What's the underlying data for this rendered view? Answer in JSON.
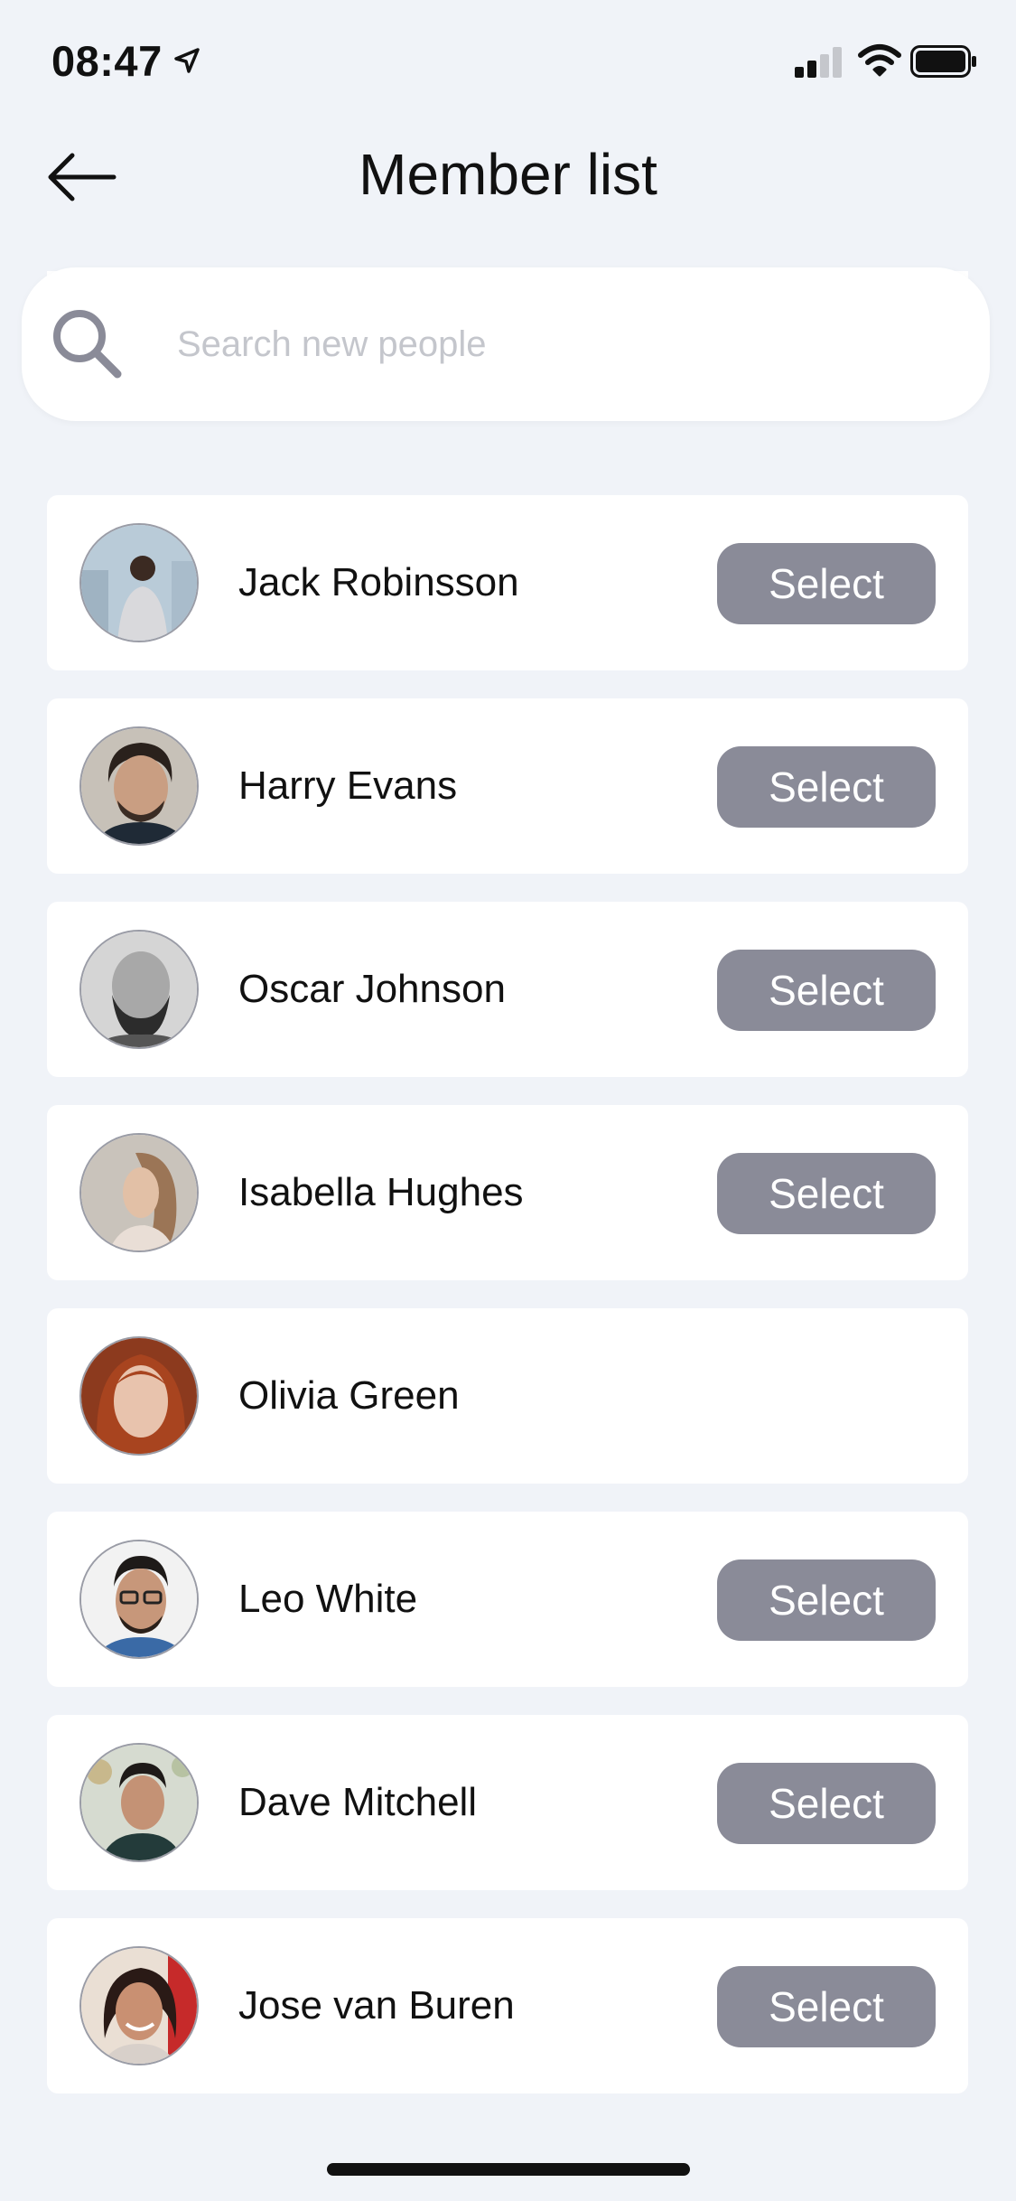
{
  "status_bar": {
    "time": "08:47",
    "icons": [
      "location-arrow-icon",
      "cellular-signal-icon",
      "wifi-icon",
      "battery-icon"
    ]
  },
  "header": {
    "title": "Member list",
    "back_icon": "arrow-left-icon"
  },
  "search": {
    "placeholder": "Search new people",
    "value": "",
    "icon": "search-icon"
  },
  "select_label": "Select",
  "members": [
    {
      "name": "Jack Robinsson",
      "has_select": true
    },
    {
      "name": "Harry Evans",
      "has_select": true
    },
    {
      "name": "Oscar Johnson",
      "has_select": true
    },
    {
      "name": "Isabella Hughes",
      "has_select": true
    },
    {
      "name": "Olivia Green",
      "has_select": false
    },
    {
      "name": "Leo White",
      "has_select": true
    },
    {
      "name": "Dave Mitchell",
      "has_select": true
    },
    {
      "name": "Jose van Buren",
      "has_select": true
    }
  ],
  "colors": {
    "background": "#f0f3f8",
    "card": "#ffffff",
    "button": "#8a8b98",
    "placeholder": "#c4c6cc"
  }
}
